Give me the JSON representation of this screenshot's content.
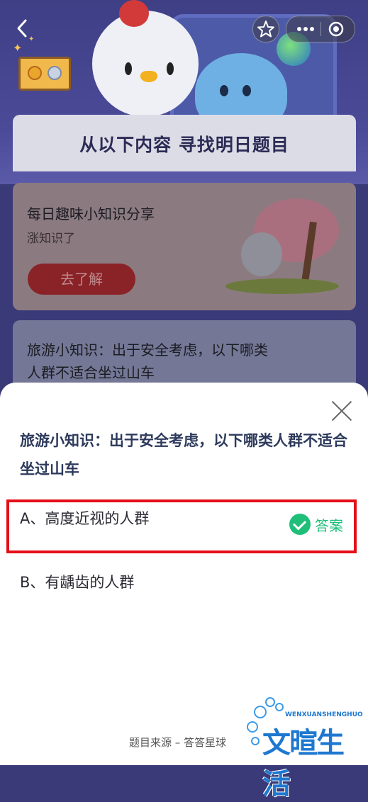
{
  "background": {
    "banner_title": "从以下内容  寻找明日题目",
    "card1": {
      "title": "每日趣味小知识分享",
      "subtitle": "涨知识了",
      "button_label": "去了解"
    },
    "card2": {
      "title_line1": "旅游小知识：出于安全考虑，以下哪类",
      "title_line2": "人群不适合坐过山车"
    }
  },
  "nav": {
    "back_icon": "chevron-left-icon",
    "star_icon": "star-icon",
    "more_icon": "more-icon",
    "close_icon": "record-circle-icon"
  },
  "sheet": {
    "question": "旅游小知识：出于安全考虑，以下哪类人群不适合坐过山车",
    "options": [
      {
        "label": "A、高度近视的人群",
        "is_answer": true
      },
      {
        "label": "B、有龋齿的人群",
        "is_answer": false
      }
    ],
    "answer_label": "答案",
    "source": "题目来源 – 答答星球"
  },
  "watermark": {
    "main": "文暄生活",
    "sub": "WENXUANSHENGHUO"
  },
  "colors": {
    "accent_green": "#1fbf7a",
    "highlight_red": "#e40e19",
    "question_text": "#2d3a5c"
  }
}
